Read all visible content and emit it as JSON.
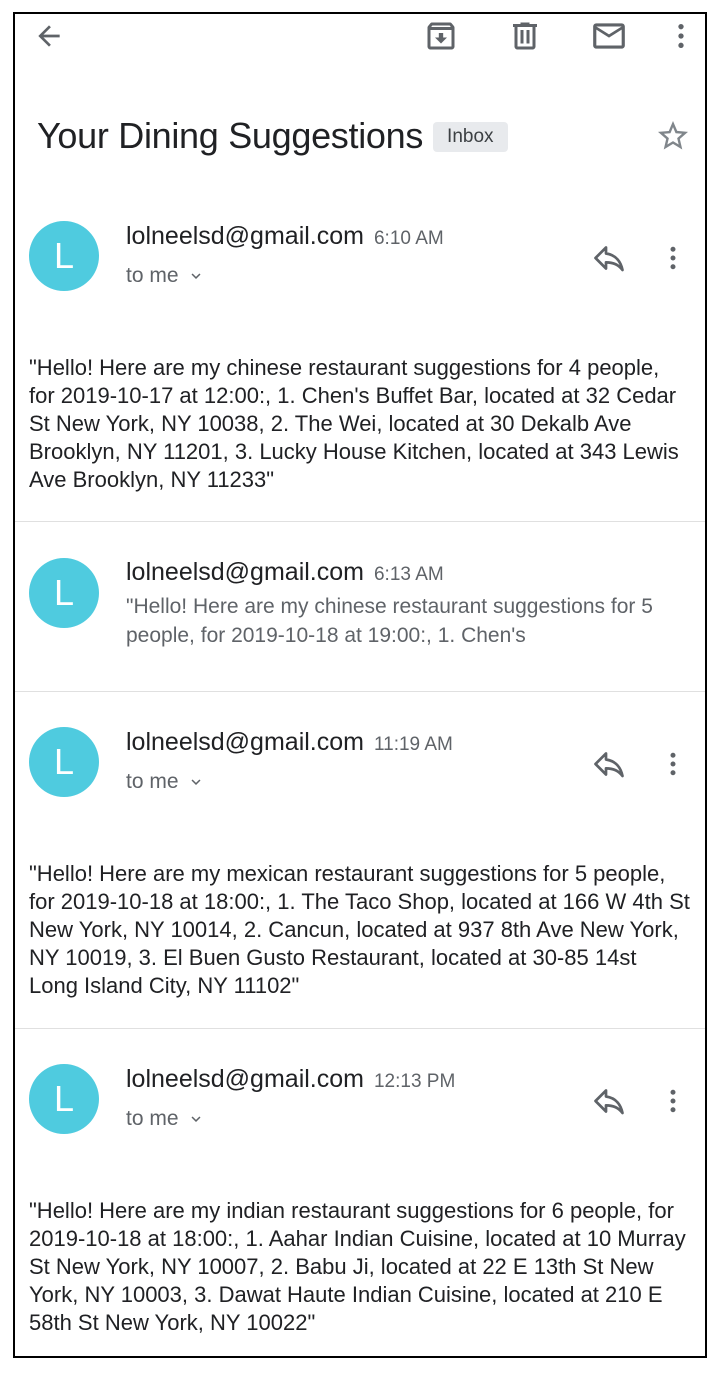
{
  "subject": "Your Dining Suggestions",
  "label": "Inbox",
  "toolbar": {
    "back_icon": "arrow-back-icon",
    "archive_icon": "archive-icon",
    "delete_icon": "trash-icon",
    "mark_unread_icon": "mail-icon",
    "more_icon": "more-vert-icon"
  },
  "colors": {
    "avatar": "#4fcbdf",
    "chip_bg": "#e8eaed",
    "secondary_text": "#5f6368"
  },
  "messages": [
    {
      "avatar": "L",
      "sender": "lolneelsd@gmail.com",
      "time": "6:10 AM",
      "recipient": "to me",
      "body": "\"Hello! Here are my chinese restaurant suggestions for 4 people, for 2019-10-17 at 12:00:, 1. Chen's Buffet Bar, located at 32 Cedar St New York, NY 10038, 2. The Wei, located at 30 Dekalb Ave Brooklyn, NY 11201, 3. Lucky House Kitchen, located at 343 Lewis Ave Brooklyn, NY 11233\""
    },
    {
      "avatar": "L",
      "sender": "lolneelsd@gmail.com",
      "time": "6:13 AM",
      "snippet": "\"Hello! Here are my chinese restaurant suggestions for 5 people, for 2019-10-18 at 19:00:, 1. Chen's"
    },
    {
      "avatar": "L",
      "sender": "lolneelsd@gmail.com",
      "time": "11:19 AM",
      "recipient": "to me",
      "body": "\"Hello! Here are my mexican restaurant suggestions for 5 people, for 2019-10-18 at 18:00:, 1. The Taco Shop, located at 166 W 4th St New York, NY 10014, 2. Cancun, located at 937 8th Ave New York, NY 10019, 3. El Buen Gusto Restaurant, located at 30-85 14st Long Island City, NY 11102\""
    },
    {
      "avatar": "L",
      "sender": "lolneelsd@gmail.com",
      "time": "12:13 PM",
      "recipient": "to me",
      "body": "\"Hello! Here are my indian restaurant suggestions for 6 people, for 2019-10-18 at 18:00:, 1. Aahar Indian Cuisine, located at 10 Murray St New York, NY 10007, 2. Babu Ji, located at 22 E 13th St New York, NY 10003, 3. Dawat Haute Indian Cuisine, located at 210 E 58th St New York, NY 10022\""
    }
  ]
}
